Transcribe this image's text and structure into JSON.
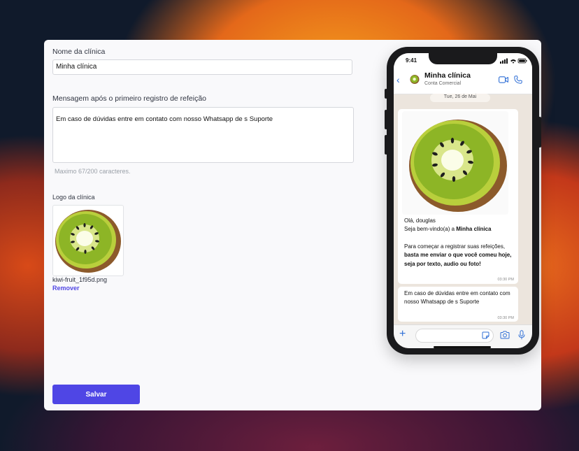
{
  "form": {
    "name_label": "Nome da clínica",
    "name_value": "Minha clínica",
    "message_label": "Mensagem após o primeiro registro de refeição",
    "message_value": "Em caso de dúvidas entre em contato com nosso Whatsapp de s Suporte",
    "char_hint": "Maximo 67/200 caracteres.",
    "logo_label": "Logo da clínica",
    "logo_filename": "kiwi-fruit_1f95d.png",
    "remove_label": "Remover",
    "save_label": "Salvar"
  },
  "phone": {
    "status_time": "9:41",
    "chat_name": "Minha clínica",
    "chat_subtitle": "Conta Comercial",
    "date_chip": "Tue, 26 de Mai",
    "message1": {
      "greeting": "Olá, douglas",
      "welcome_prefix": "Seja bem-vindo(a) a ",
      "welcome_bold": "Minha clínica",
      "instruction_prefix": "Para começar a registrar suas refeições, ",
      "instruction_bold": "basta me enviar o que você comeu hoje, seja por texto, audio ou foto!",
      "time": "03:30 PM"
    },
    "message2": {
      "text": "Em caso de dúvidas entre em contato com nosso Whatsapp de s Suporte",
      "time": "03:30 PM"
    }
  },
  "colors": {
    "primary": "#4f46e5",
    "link": "#5046e4",
    "whatsapp_icon_blue": "#2f6fd6",
    "chat_background": "#ece5dd"
  },
  "icons": [
    "back-chevron-icon",
    "video-call-icon",
    "phone-call-icon",
    "plus-icon",
    "sticker-icon",
    "camera-icon",
    "microphone-icon",
    "kiwi-image"
  ]
}
